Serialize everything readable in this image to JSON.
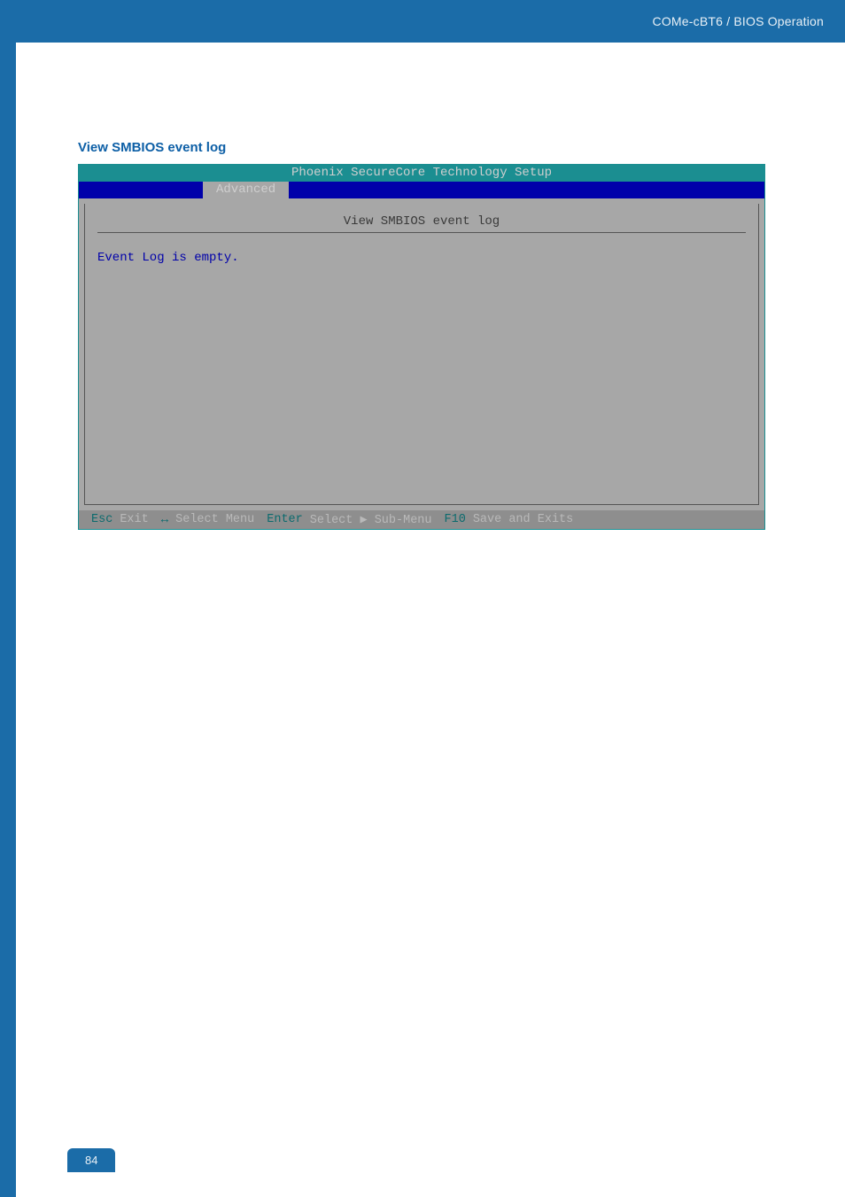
{
  "header": {
    "breadcrumb": "COMe-cBT6 / BIOS Operation"
  },
  "section": {
    "title": "View SMBIOS event log"
  },
  "bios": {
    "title": "Phoenix SecureCore Technology Setup",
    "active_tab": "Advanced",
    "panel_title": "View SMBIOS event log",
    "panel_body": "Event Log is empty.",
    "footer": {
      "esc_key": "Esc",
      "esc_label": "Exit",
      "arrows_label": "Select Menu",
      "enter_key": "Enter",
      "enter_label": "Select ▶ Sub-Menu",
      "f10_key": "F10",
      "f10_label": "Save and Exits"
    }
  },
  "page_number": "84"
}
